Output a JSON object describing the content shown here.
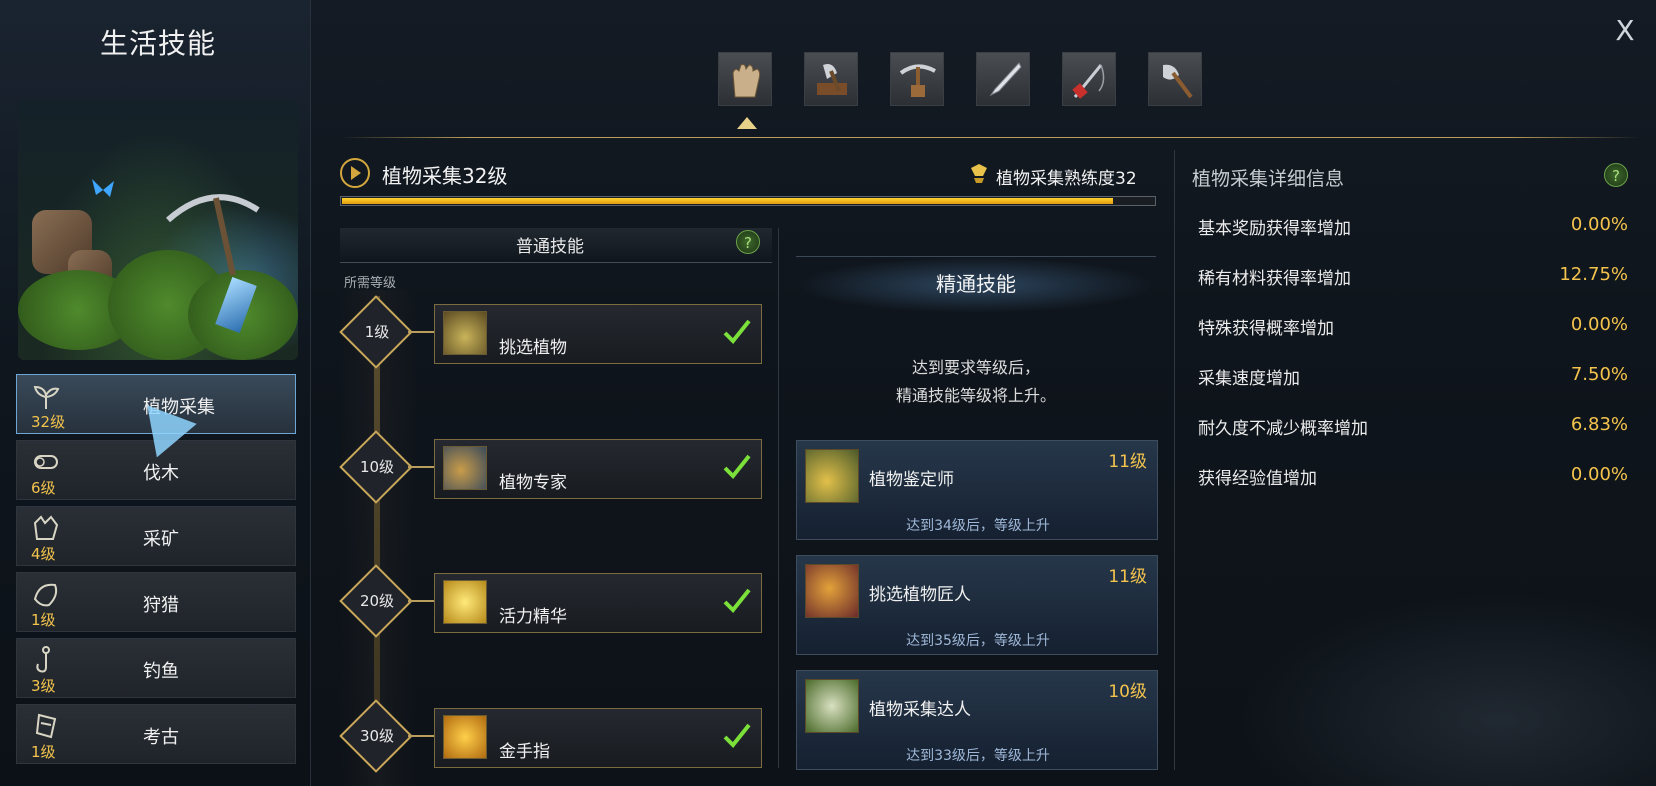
{
  "sidebar": {
    "title": "生活技能",
    "items": [
      {
        "name": "植物采集",
        "level": "32级",
        "icon": "sprout-icon",
        "active": true
      },
      {
        "name": "伐木",
        "level": "6级",
        "icon": "log-icon",
        "active": false
      },
      {
        "name": "采矿",
        "level": "4级",
        "icon": "ore-icon",
        "active": false
      },
      {
        "name": "狩猎",
        "level": "1级",
        "icon": "hunt-icon",
        "active": false
      },
      {
        "name": "钓鱼",
        "level": "3级",
        "icon": "hook-icon",
        "active": false
      },
      {
        "name": "考古",
        "level": "1级",
        "icon": "dig-icon",
        "active": false
      }
    ]
  },
  "tool_tabs": [
    "gloves-icon",
    "axe-icon",
    "pickaxe-icon",
    "knife-icon",
    "fishing-rod-icon",
    "shovel-icon"
  ],
  "header": {
    "title": "植物采集32级",
    "proficiency": "植物采集熟练度32",
    "progress_percent": 95
  },
  "normal": {
    "title": "普通技能",
    "required_level_label": "所需等级",
    "skills": [
      {
        "level": "1级",
        "name": "挑选植物",
        "learned": true
      },
      {
        "level": "10级",
        "name": "植物专家",
        "learned": true
      },
      {
        "level": "20级",
        "name": "活力精华",
        "learned": true
      },
      {
        "level": "30级",
        "name": "金手指",
        "learned": true
      }
    ]
  },
  "mastery": {
    "title": "精通技能",
    "desc_line1": "达到要求等级后，",
    "desc_line2": "精通技能等级将上升。",
    "skills": [
      {
        "name": "植物鉴定师",
        "level": "11级",
        "note": "达到34级后，等级上升"
      },
      {
        "name": "挑选植物匠人",
        "level": "11级",
        "note": "达到35级后，等级上升"
      },
      {
        "name": "植物采集达人",
        "level": "10级",
        "note": "达到33级后，等级上升"
      }
    ]
  },
  "details": {
    "title": "植物采集详细信息",
    "rows": [
      {
        "label": "基本奖励获得率增加",
        "value": "0.00%"
      },
      {
        "label": "稀有材料获得率增加",
        "value": "12.75%"
      },
      {
        "label": "特殊获得概率增加",
        "value": "0.00%"
      },
      {
        "label": "采集速度增加",
        "value": "7.50%"
      },
      {
        "label": "耐久度不减少概率增加",
        "value": "6.83%"
      },
      {
        "label": "获得经验值增加",
        "value": "0.00%"
      }
    ]
  },
  "close_label": "X",
  "help_label": "?",
  "colors": {
    "accent_gold": "#f3c34d",
    "active_border": "#6ea6d6",
    "check_green": "#7be03a"
  }
}
